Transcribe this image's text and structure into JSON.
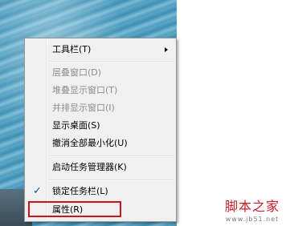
{
  "context_menu": {
    "items": [
      {
        "label": "工具栏(T)",
        "disabled": false,
        "has_submenu": true
      },
      {
        "label": "层叠窗口(D)",
        "disabled": true
      },
      {
        "label": "堆叠显示窗口(T)",
        "disabled": true
      },
      {
        "label": "并排显示窗口(I)",
        "disabled": true
      },
      {
        "label": "显示桌面(S)",
        "disabled": false
      },
      {
        "label": "撤消全部最小化(U)",
        "disabled": false
      },
      {
        "label": "启动任务管理器(K)",
        "disabled": false
      },
      {
        "label": "锁定任务栏(L)",
        "disabled": false,
        "checked": true
      },
      {
        "label": "属性(R)",
        "disabled": false,
        "highlighted": true
      }
    ],
    "check_mark": "✓"
  },
  "watermark": {
    "logo_text": "脚本之家",
    "url": "www.jb51.net"
  },
  "colors": {
    "highlight_border": "#c8161d",
    "watermark_red": "#c81e24",
    "disabled_text": "#8d8d8d"
  }
}
